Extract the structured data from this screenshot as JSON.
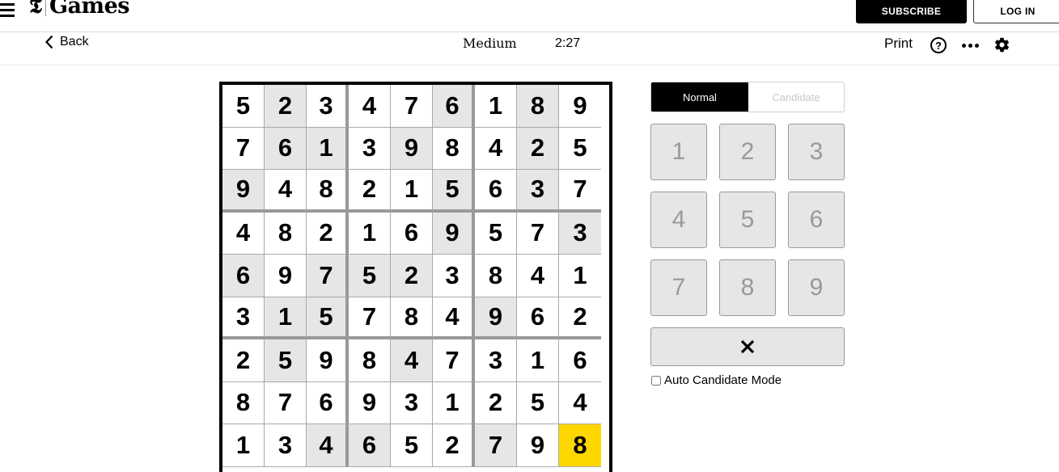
{
  "header": {
    "logo_mark": "𝕿",
    "logo_text": "Games",
    "subscribe_label": "SUBSCRIBE",
    "login_label": "LOG IN"
  },
  "toolbar": {
    "back_label": "Back",
    "difficulty": "Medium",
    "timer": "2:27",
    "print_label": "Print",
    "help_glyph": "?",
    "icons": [
      "menu-icon",
      "chevron-left-icon",
      "help-icon",
      "more-icon",
      "gear-icon"
    ]
  },
  "board": {
    "rows": [
      [
        5,
        2,
        3,
        4,
        7,
        6,
        1,
        8,
        9
      ],
      [
        7,
        6,
        1,
        3,
        9,
        8,
        4,
        2,
        5
      ],
      [
        9,
        4,
        8,
        2,
        1,
        5,
        6,
        3,
        7
      ],
      [
        4,
        8,
        2,
        1,
        6,
        9,
        5,
        7,
        3
      ],
      [
        6,
        9,
        7,
        5,
        2,
        3,
        8,
        4,
        1
      ],
      [
        3,
        1,
        5,
        7,
        8,
        4,
        9,
        6,
        2
      ],
      [
        2,
        5,
        9,
        8,
        4,
        7,
        3,
        1,
        6
      ],
      [
        8,
        7,
        6,
        9,
        3,
        1,
        2,
        5,
        4
      ],
      [
        1,
        3,
        4,
        6,
        5,
        2,
        7,
        9,
        8
      ]
    ],
    "shaded": [
      [
        0,
        1
      ],
      [
        0,
        5
      ],
      [
        0,
        7
      ],
      [
        1,
        1
      ],
      [
        1,
        2
      ],
      [
        1,
        4
      ],
      [
        1,
        7
      ],
      [
        2,
        0
      ],
      [
        2,
        5
      ],
      [
        2,
        7
      ],
      [
        3,
        5
      ],
      [
        3,
        8
      ],
      [
        4,
        0
      ],
      [
        4,
        2
      ],
      [
        4,
        3
      ],
      [
        4,
        4
      ],
      [
        5,
        1
      ],
      [
        5,
        2
      ],
      [
        5,
        6
      ],
      [
        6,
        1
      ],
      [
        6,
        4
      ],
      [
        8,
        2
      ],
      [
        8,
        3
      ],
      [
        8,
        6
      ]
    ],
    "selected": [
      8,
      8
    ],
    "colors": {
      "shaded": "#e6e6e6",
      "selected": "#ffd700"
    }
  },
  "controls": {
    "mode_normal": "Normal",
    "mode_candidate": "Candidate",
    "active_mode": "Normal",
    "numbers": [
      "1",
      "2",
      "3",
      "4",
      "5",
      "6",
      "7",
      "8",
      "9"
    ],
    "delete_icon": "close-icon",
    "auto_candidate_label": "Auto Candidate Mode",
    "auto_candidate_checked": false
  }
}
